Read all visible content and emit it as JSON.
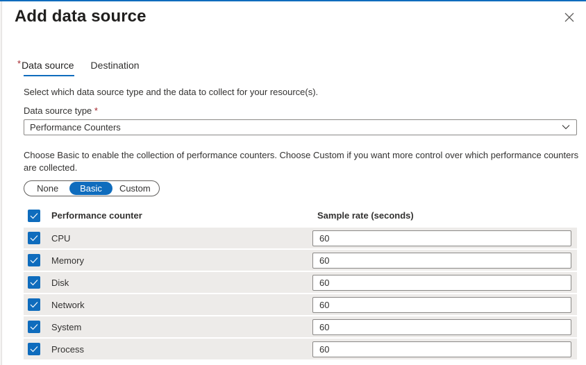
{
  "panel": {
    "title": "Add data source",
    "close_icon": "close-icon"
  },
  "tabs": [
    {
      "label": "Data source",
      "required": "*",
      "active": true
    },
    {
      "label": "Destination",
      "required": "",
      "active": false
    }
  ],
  "form": {
    "description": "Select which data source type and the data to collect for your resource(s).",
    "data_source_type": {
      "label": "Data source type",
      "required": "*",
      "value": "Performance Counters"
    },
    "collection_description": "Choose Basic to enable the collection of performance counters. Choose Custom if you want more control over which performance counters are collected.",
    "collection_mode": {
      "options": [
        "None",
        "Basic",
        "Custom"
      ],
      "selected": "Basic"
    }
  },
  "counters_table": {
    "columns": [
      "Performance counter",
      "Sample rate (seconds)"
    ],
    "select_all_checked": true,
    "rows": [
      {
        "counter": "CPU",
        "checked": true,
        "sample_rate": "60"
      },
      {
        "counter": "Memory",
        "checked": true,
        "sample_rate": "60"
      },
      {
        "counter": "Disk",
        "checked": true,
        "sample_rate": "60"
      },
      {
        "counter": "Network",
        "checked": true,
        "sample_rate": "60"
      },
      {
        "counter": "System",
        "checked": true,
        "sample_rate": "60"
      },
      {
        "counter": "Process",
        "checked": true,
        "sample_rate": "60"
      }
    ]
  },
  "colors": {
    "accent": "#0f6cbd",
    "required": "#a4262c",
    "row_background": "#edebe9"
  }
}
